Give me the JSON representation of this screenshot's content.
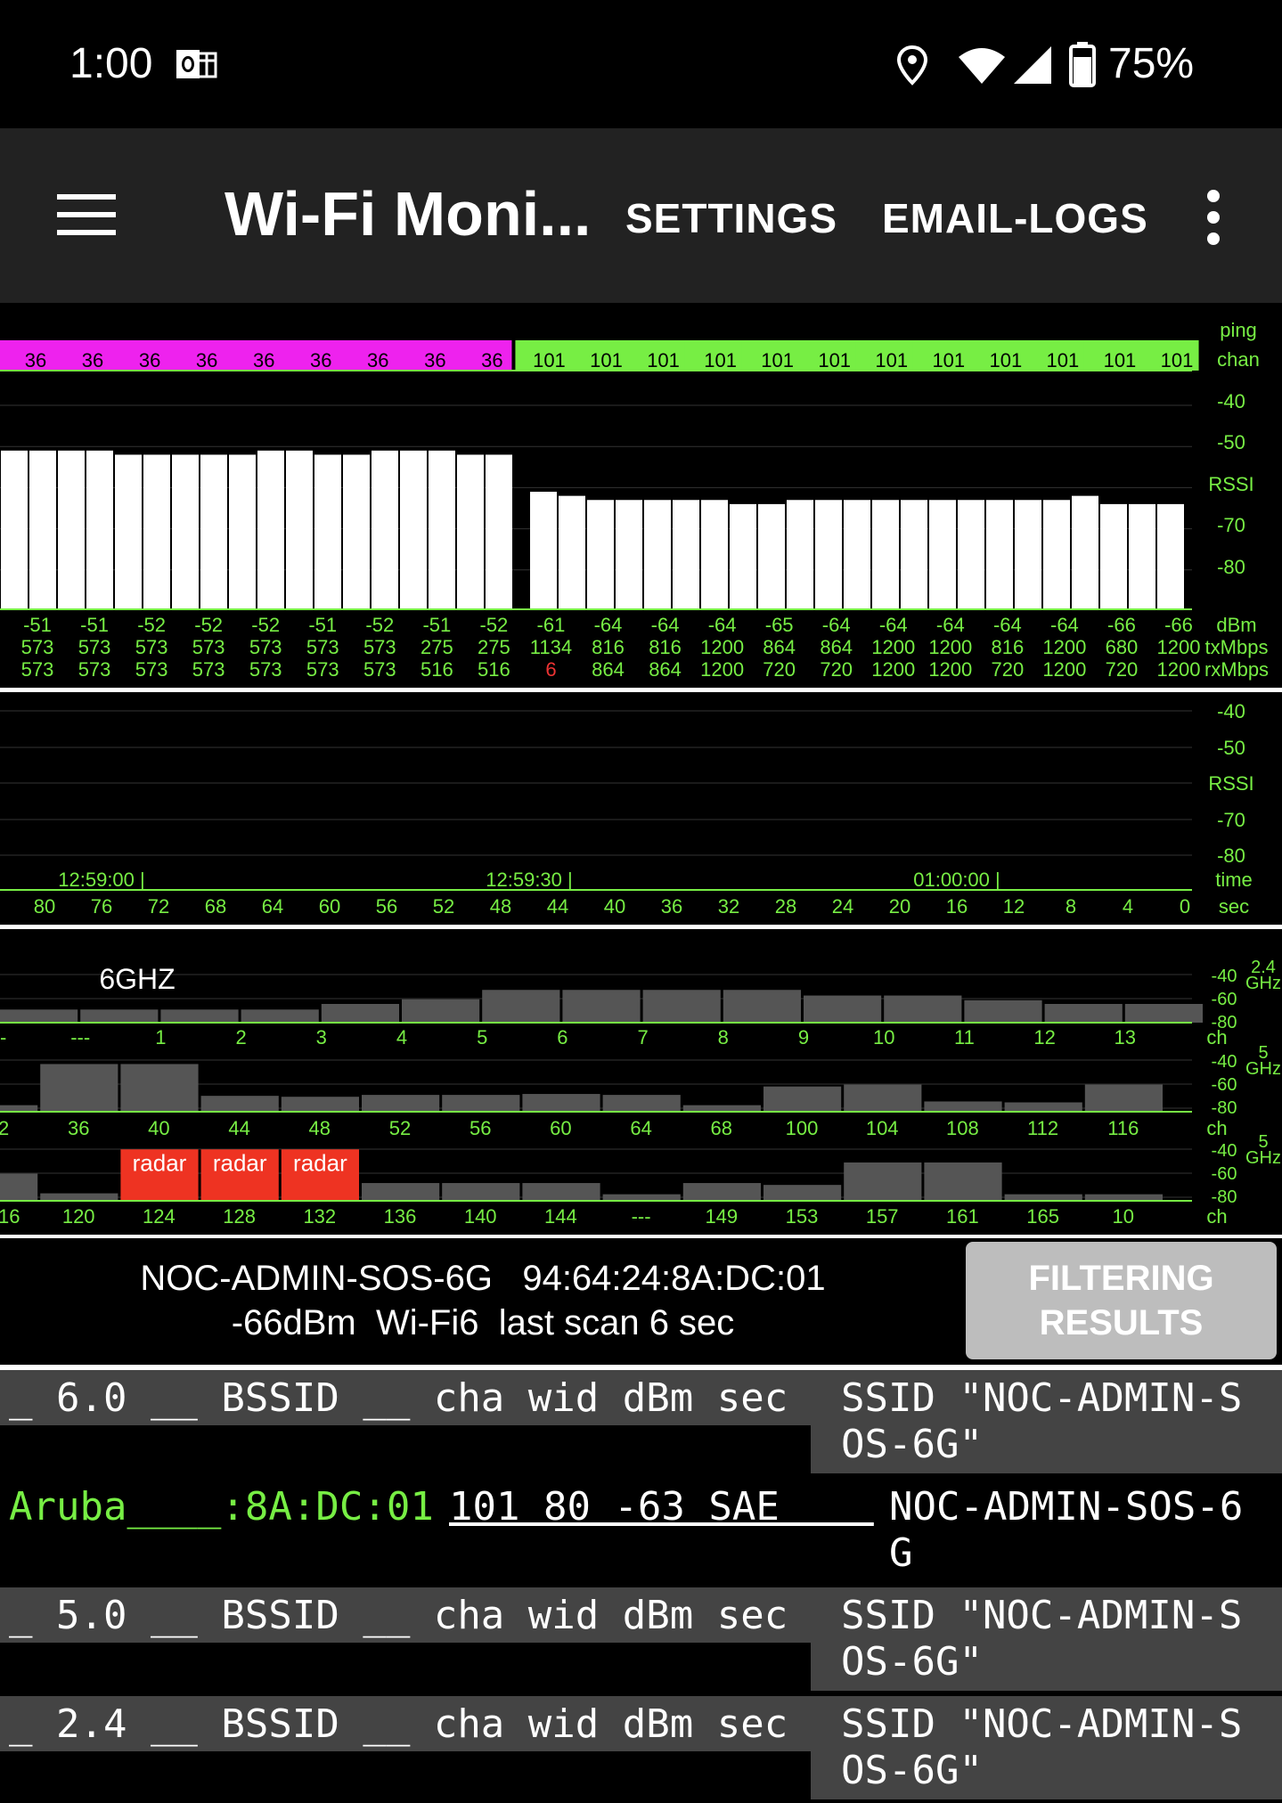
{
  "status_bar": {
    "time": "1:00",
    "battery": "75%",
    "icons": [
      "outlook-icon",
      "location-icon",
      "wifi-icon",
      "signal-icon",
      "battery-icon"
    ]
  },
  "app_bar": {
    "title": "Wi-Fi Moni...",
    "settings": "SETTINGS",
    "email_logs": "EMAIL-LOGS",
    "icons": [
      "menu-icon",
      "more-vert-icon"
    ]
  },
  "top_chart": {
    "labels_right": {
      "ping": "ping",
      "chan": "chan",
      "rssi": "RSSI",
      "dbm": "dBm",
      "tx": "txMbps",
      "rx": "rxMbps"
    },
    "y_ticks": [
      "-40",
      "-50",
      "RSSI",
      "-70",
      "-80"
    ]
  },
  "mid_chart": {
    "y_ticks": [
      "-40",
      "-50",
      "RSSI",
      "-70",
      "-80"
    ],
    "times": [
      "12:59:00 |",
      "12:59:30 |",
      "01:00:00 |"
    ],
    "time_label": "time",
    "sec_label": "sec",
    "secs": [
      "80",
      "76",
      "72",
      "68",
      "64",
      "60",
      "56",
      "52",
      "48",
      "44",
      "40",
      "36",
      "32",
      "28",
      "24",
      "20",
      "16",
      "12",
      "8",
      "4",
      "0"
    ]
  },
  "chart_data": [
    {
      "type": "bar",
      "title": "",
      "channels": [
        "36",
        "36",
        "36",
        "36",
        "36",
        "36",
        "36",
        "36",
        "36",
        "101",
        "101",
        "101",
        "101",
        "101",
        "101",
        "101",
        "101",
        "101",
        "101",
        "101",
        "101"
      ],
      "channel_colors": {
        "36": "#ee22ee",
        "101": "#77ee44"
      },
      "dbm": [
        -51,
        -51,
        -52,
        -52,
        -52,
        -51,
        -52,
        -51,
        -52,
        -61,
        -64,
        -64,
        -64,
        -65,
        -64,
        -64,
        -64,
        -64,
        -64,
        -66,
        -66
      ],
      "tx": [
        "573",
        "573",
        "573",
        "573",
        "573",
        "573",
        "573",
        "275",
        "275",
        "1134",
        "816",
        "816",
        "1200",
        "864",
        "864",
        "1200",
        "1200",
        "816",
        "1200",
        "680",
        "1200"
      ],
      "rx": [
        "573",
        "573",
        "573",
        "573",
        "573",
        "573",
        "573",
        "516",
        "516",
        "6",
        "864",
        "864",
        "1200",
        "720",
        "720",
        "1200",
        "1200",
        "720",
        "1200",
        "720",
        "1200"
      ],
      "rssi_bars": [
        -51,
        -51,
        -51,
        -51,
        -52,
        -52,
        -52,
        -52,
        -52,
        -51,
        -51,
        -52,
        -52,
        -51,
        -51,
        -51,
        -52,
        -52,
        -61,
        -62,
        -63,
        -63,
        -63,
        -63,
        -63,
        -64,
        -64,
        -63,
        -63,
        -63,
        -63,
        -63,
        -63,
        -63,
        -63,
        -63,
        -63,
        -62,
        -64,
        -64,
        -64
      ],
      "ylim": [
        -88,
        -35
      ]
    },
    {
      "type": "bar",
      "title": "6GHZ",
      "band": "2.4 GHz",
      "y_ticks": [
        "-40",
        "-60",
        "-80"
      ],
      "channels": [
        "--",
        "---",
        "1",
        "2",
        "3",
        "4",
        "5",
        "6",
        "7",
        "8",
        "9",
        "10",
        "11",
        "12",
        "13"
      ],
      "levels": [
        -81,
        -81,
        -81,
        -81,
        -75,
        -70,
        -60,
        -60,
        -60,
        -60,
        -66,
        -66,
        -71,
        -75,
        -75
      ],
      "xlabel": "ch"
    },
    {
      "type": "bar",
      "band": "5 GHz",
      "y_ticks": [
        "-40",
        "-60",
        "-80"
      ],
      "channels": [
        "2",
        "36",
        "40",
        "44",
        "48",
        "52",
        "56",
        "60",
        "64",
        "68",
        "100",
        "104",
        "108",
        "112",
        "116"
      ],
      "levels": [
        -88,
        -44,
        -44,
        -78,
        -79,
        -77,
        -77,
        -76,
        -77,
        -88,
        -68,
        -66,
        -84,
        -85,
        -66
      ],
      "xlabel": "ch"
    },
    {
      "type": "bar",
      "band": "5 GHz",
      "y_ticks": [
        "-40",
        "-60",
        "-80"
      ],
      "channels": [
        "16",
        "120",
        "124",
        "128",
        "132",
        "136",
        "140",
        "144",
        "---",
        "149",
        "153",
        "157",
        "161",
        "165",
        "10"
      ],
      "levels": [
        -66,
        -87,
        -40,
        -40,
        -40,
        -76,
        -76,
        -76,
        -88,
        -76,
        -78,
        -54,
        -54,
        -88,
        -88
      ],
      "radar": [
        "",
        "",
        "radar",
        "radar",
        "radar",
        "",
        "",
        "",
        "",
        "",
        "",
        "",
        "",
        "",
        ""
      ],
      "xlabel": "ch"
    }
  ],
  "info": {
    "line1": "NOC-ADMIN-SOS-6G   94:64:24:8A:DC:01",
    "line2": "-66dBm  Wi-Fi6  last scan 6 sec",
    "filter_btn": "FILTERING RESULTS"
  },
  "rows": {
    "h60": {
      "left": "_ 6.0 __ BSSID __ cha wid dBm sec",
      "ssid1": "SSID \"NOC-ADMIN-S",
      "ssid2": "OS-6G\""
    },
    "ap": {
      "vendor": "Aruba____:8A:DC:01",
      "vals": "101 80 -63 SAE    ",
      "ssid1": "NOC-ADMIN-SOS-6",
      "ssid2": "G"
    },
    "h50": {
      "left": "_ 5.0 __ BSSID __ cha wid dBm sec",
      "ssid1": "SSID \"NOC-ADMIN-S",
      "ssid2": "OS-6G\""
    },
    "h24": {
      "left": "_ 2.4 __ BSSID __ cha wid dBm sec",
      "ssid1": "SSID \"NOC-ADMIN-S",
      "ssid2": "OS-6G\""
    }
  }
}
